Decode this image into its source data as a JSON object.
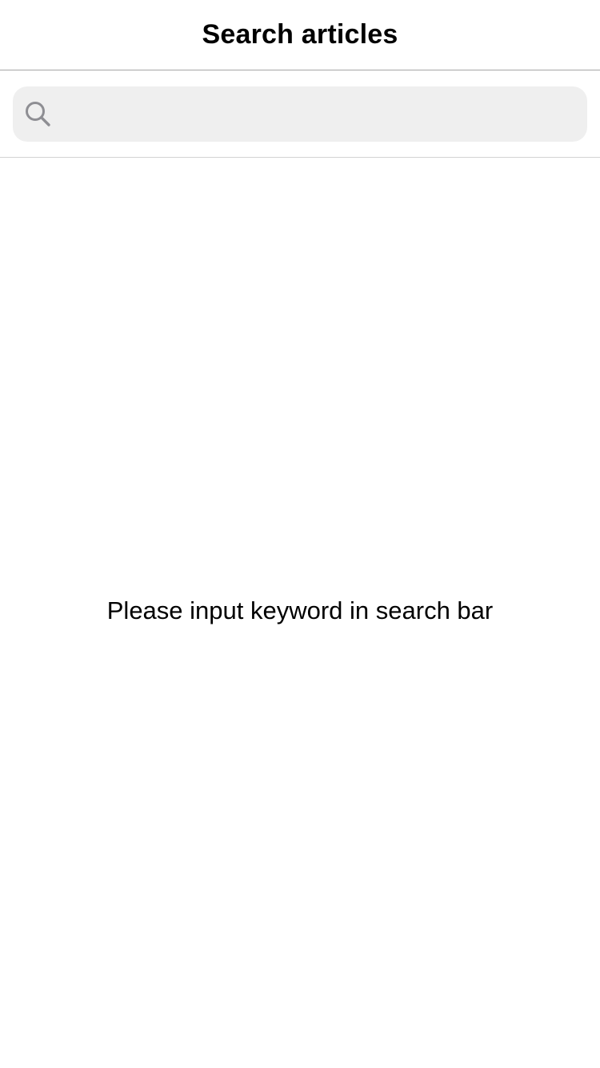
{
  "nav": {
    "title": "Search articles"
  },
  "search": {
    "icon": "search-icon",
    "value": "",
    "placeholder": ""
  },
  "main": {
    "empty_message": "Please input keyword in search bar"
  },
  "colors": {
    "background": "#ffffff",
    "search_bar_bg": "#efefef",
    "icon": "#8e8e93",
    "divider": "#a6a6a6"
  }
}
